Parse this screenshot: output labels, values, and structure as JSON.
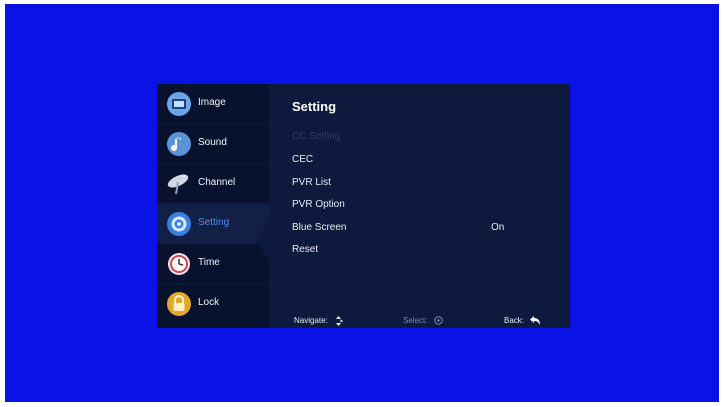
{
  "sidebar": {
    "items": [
      {
        "label": "Image",
        "icon": "image-icon"
      },
      {
        "label": "Sound",
        "icon": "music-note-icon"
      },
      {
        "label": "Channel",
        "icon": "satellite-dish-icon"
      },
      {
        "label": "Setting",
        "icon": "settings-icon",
        "active": true
      },
      {
        "label": "Time",
        "icon": "clock-icon"
      },
      {
        "label": "Lock",
        "icon": "lock-icon"
      }
    ]
  },
  "main": {
    "title": "Setting",
    "options": [
      {
        "label": "CC Setting",
        "value": "",
        "disabled": true
      },
      {
        "label": "CEC",
        "value": ""
      },
      {
        "label": "PVR List",
        "value": ""
      },
      {
        "label": "PVR Option",
        "value": ""
      },
      {
        "label": "Blue Screen",
        "value": "On"
      },
      {
        "label": "Reset",
        "value": ""
      }
    ]
  },
  "footer": {
    "navigate": "Navigate:",
    "select": "Select:",
    "back": "Back:"
  },
  "colors": {
    "screen_background": "#0a12e6",
    "panel": "#0d1a3d",
    "sidebar": "#08122e",
    "accent": "#4f8df0"
  }
}
